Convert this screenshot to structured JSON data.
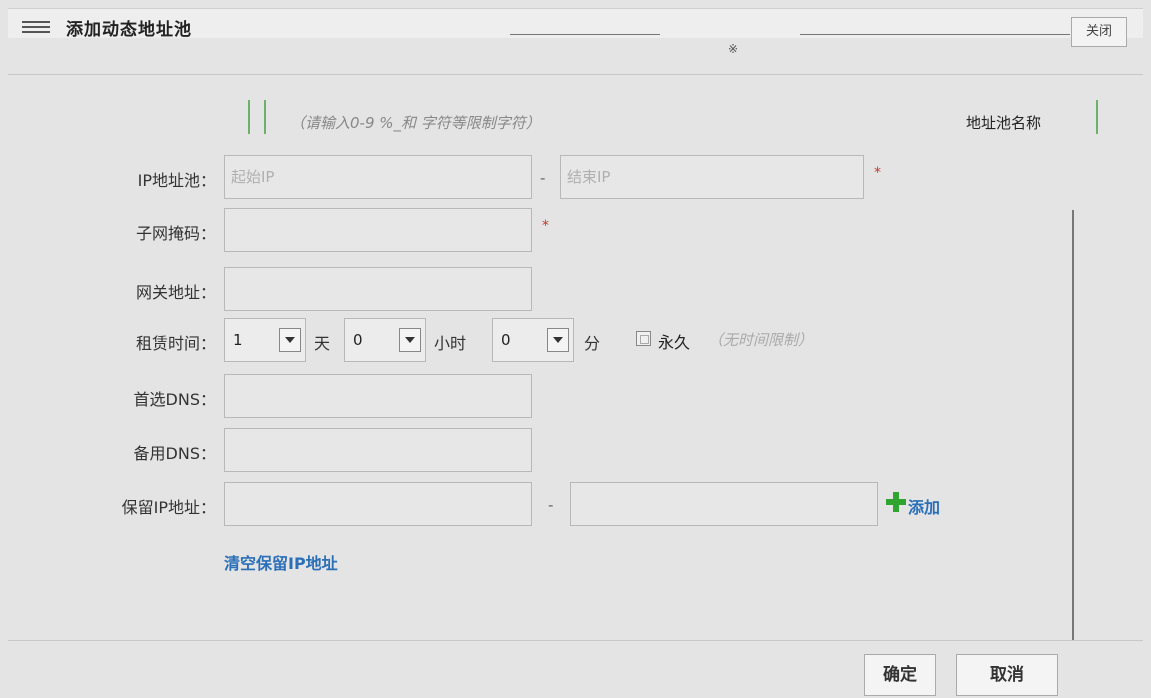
{
  "dialog": {
    "title": "添加动态地址池",
    "title_glyph": "※",
    "title_button": "关闭"
  },
  "hint": {
    "text": "（请输入0-9 %_和 字符等限制字符）",
    "pool_name_label": "地址池名称"
  },
  "form": {
    "ip_pool": {
      "label": "IP地址池：",
      "start_placeholder": "起始IP",
      "separator": "-",
      "end_placeholder": "结束IP",
      "required_mark": "*"
    },
    "subnet_mask": {
      "label": "子网掩码：",
      "value": "",
      "required_mark": "*"
    },
    "gateway": {
      "label": "网关地址：",
      "value": ""
    },
    "lease": {
      "label": "租赁时间：",
      "days": {
        "value": "1",
        "unit": "天"
      },
      "hours": {
        "value": "0",
        "unit": "小时"
      },
      "minutes": {
        "value": "0",
        "unit": "分"
      },
      "permanent_label": "永久",
      "permanent_checked": false,
      "permanent_note": "（无时间限制）"
    },
    "primary_dns": {
      "label": "首选DNS：",
      "value": ""
    },
    "secondary_dns": {
      "label": "备用DNS：",
      "value": ""
    },
    "reserved_ip": {
      "label": "保留IP地址：",
      "separator": "-",
      "add_label": "添加",
      "add_icon": "plus-icon",
      "add_icon_color": "#2fa52f"
    },
    "clear_reserved_label": "清空保留IP地址"
  },
  "footer": {
    "ok_label": "确定",
    "cancel_label": "取消"
  },
  "colors": {
    "link": "#2a6fb8",
    "required": "#c0392b",
    "background": "#e4e4e4"
  }
}
